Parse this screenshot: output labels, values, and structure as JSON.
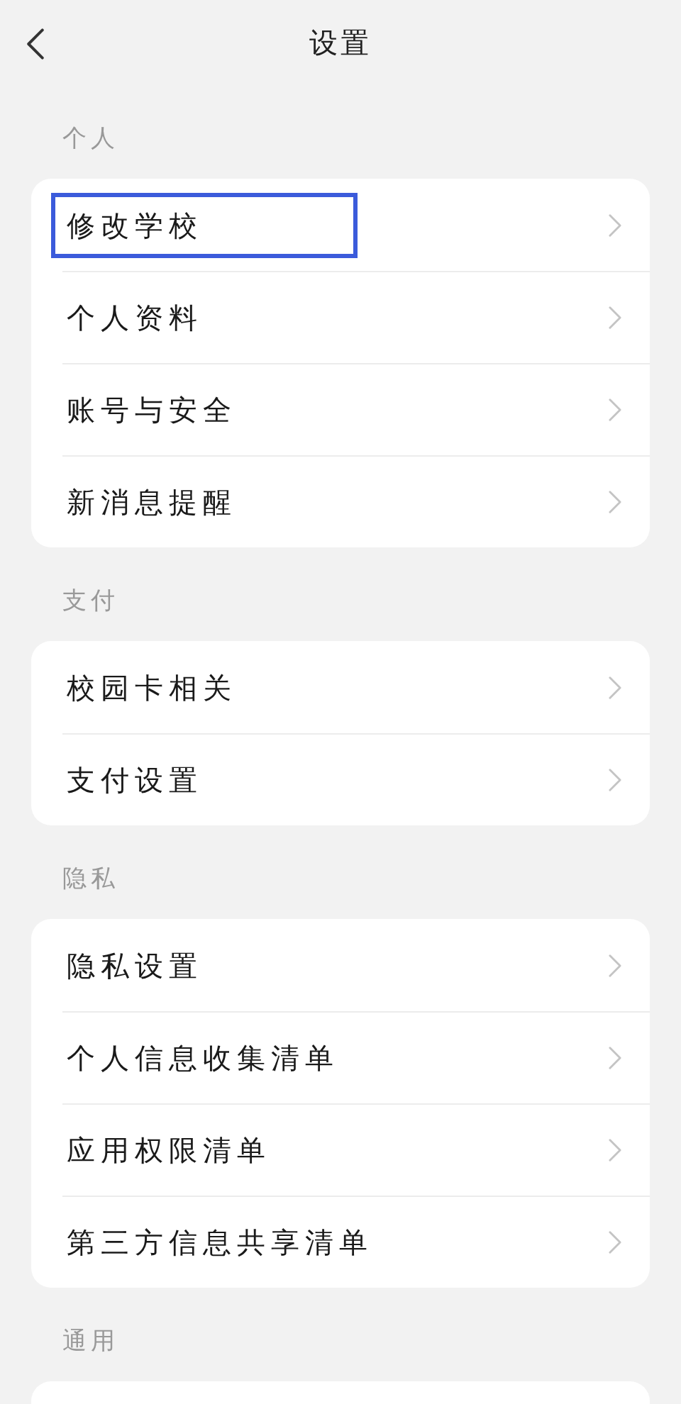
{
  "header": {
    "title": "设置"
  },
  "sections": [
    {
      "label": "个人",
      "items": [
        {
          "label": "修改学校",
          "highlighted": true
        },
        {
          "label": "个人资料",
          "highlighted": false
        },
        {
          "label": "账号与安全",
          "highlighted": false
        },
        {
          "label": "新消息提醒",
          "highlighted": false
        }
      ]
    },
    {
      "label": "支付",
      "items": [
        {
          "label": "校园卡相关",
          "highlighted": false
        },
        {
          "label": "支付设置",
          "highlighted": false
        }
      ]
    },
    {
      "label": "隐私",
      "items": [
        {
          "label": "隐私设置",
          "highlighted": false
        },
        {
          "label": "个人信息收集清单",
          "highlighted": false
        },
        {
          "label": "应用权限清单",
          "highlighted": false
        },
        {
          "label": "第三方信息共享清单",
          "highlighted": false
        }
      ]
    },
    {
      "label": "通用"
    }
  ]
}
